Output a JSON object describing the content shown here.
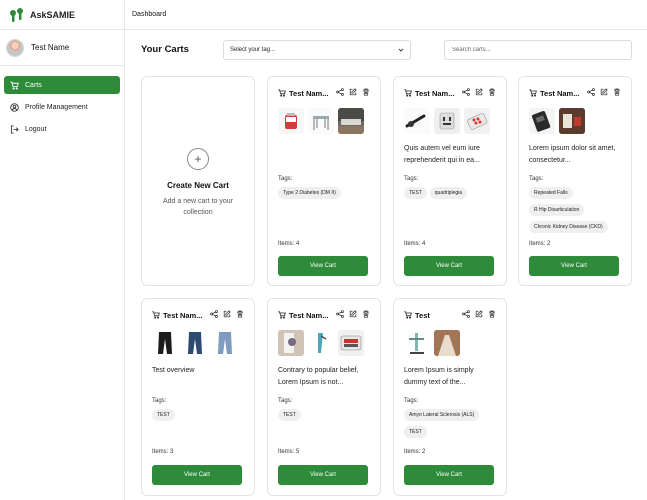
{
  "brand": {
    "name": "AskSAMIE"
  },
  "user": {
    "name": "Test Name"
  },
  "nav": {
    "items": [
      {
        "label": "Carts",
        "icon": "cart-icon",
        "active": true
      },
      {
        "label": "Profile Management",
        "icon": "user-circle-icon",
        "active": false
      },
      {
        "label": "Logout",
        "icon": "logout-icon",
        "active": false
      }
    ]
  },
  "header": {
    "breadcrumb": "Dashboard"
  },
  "toolbar": {
    "title": "Your Carts",
    "tag_select": "Select your tag...",
    "search_placeholder": "Search carts..."
  },
  "create_card": {
    "title": "Create New Cart",
    "description": "Add a new cart to your collection"
  },
  "labels": {
    "tags": "Tags:",
    "view_cart": "View Cart"
  },
  "cards": [
    {
      "name": "Test Nam...",
      "description": "",
      "tags": [
        "Type 2 Diabetes (DM II)"
      ],
      "items": "Items: 4"
    },
    {
      "name": "Test Nam...",
      "description": "Quis autem vel eum iure reprehenderit qui in ea...",
      "tags": [
        "TEST",
        "quadriplegia"
      ],
      "items": "Items: 4"
    },
    {
      "name": "Test Nam...",
      "description": "Lorem ipsum dolor sit amet, consectetur...",
      "tags": [
        "Repeated Falls",
        "R Hip Disarticulation",
        "Chronic Kidney Disease (CKD)"
      ],
      "items": "Items: 2"
    },
    {
      "name": "Test Nam...",
      "description": "Test overview",
      "tags": [
        "TEST"
      ],
      "items": "Items: 3"
    },
    {
      "name": "Test Nam...",
      "description": "Contrary to popular belief, Lorem Ipsum is not...",
      "tags": [
        "TEST"
      ],
      "items": "Items: 5"
    },
    {
      "name": "Test",
      "description": "Lorem Ipsum is simply dummy text of the...",
      "tags": [
        "Amyo Lateral Sclerosis (ALS)",
        "TEST"
      ],
      "items": "Items: 2"
    }
  ],
  "colors": {
    "accent": "#2e8b3a"
  }
}
